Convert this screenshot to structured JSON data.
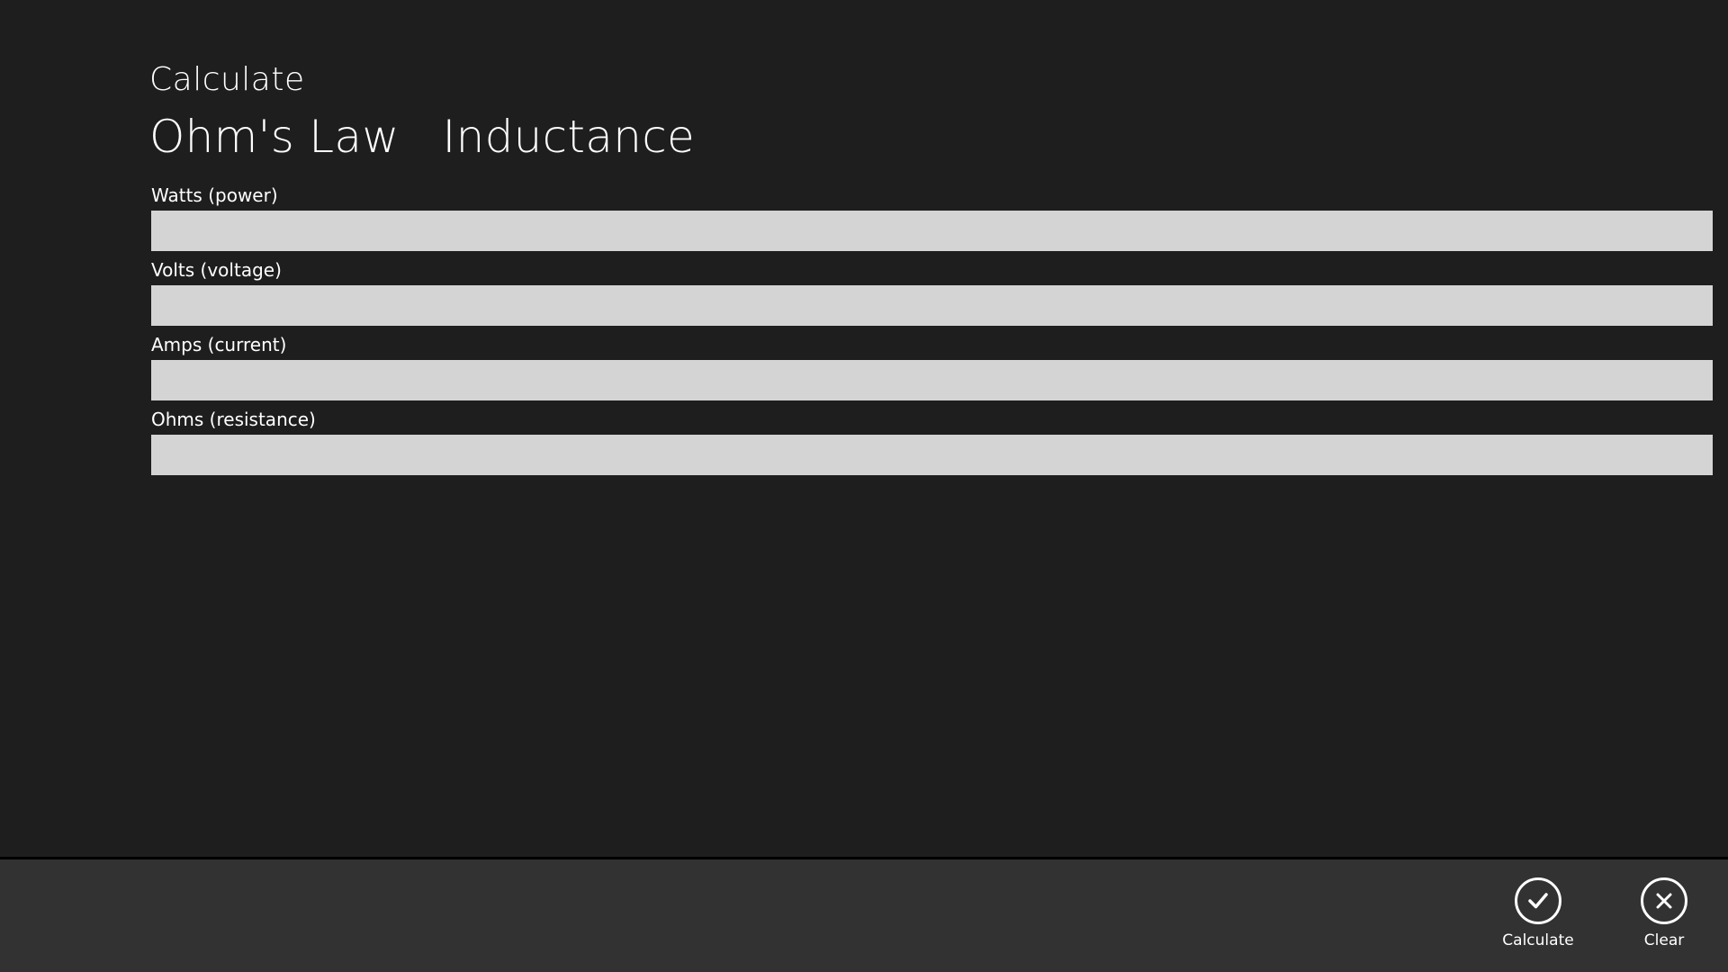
{
  "header": {
    "app_title": "Calculate",
    "tabs": [
      {
        "label": "Ohm's Law"
      },
      {
        "label": "Inductance"
      }
    ]
  },
  "form": {
    "fields": [
      {
        "label": "Watts (power)",
        "value": "",
        "placeholder": ""
      },
      {
        "label": "Volts (voltage)",
        "value": "",
        "placeholder": ""
      },
      {
        "label": "Amps (current)",
        "value": "",
        "placeholder": ""
      },
      {
        "label": "Ohms (resistance)",
        "value": "",
        "placeholder": ""
      }
    ]
  },
  "app_bar": {
    "calculate": {
      "label": "Calculate",
      "icon": "checkmark-icon"
    },
    "clear": {
      "label": "Clear",
      "icon": "close-icon"
    }
  },
  "colors": {
    "background": "#1e1e1e",
    "input_fill": "#d4d4d4",
    "app_bar": "#323232",
    "text": "#ffffff"
  }
}
